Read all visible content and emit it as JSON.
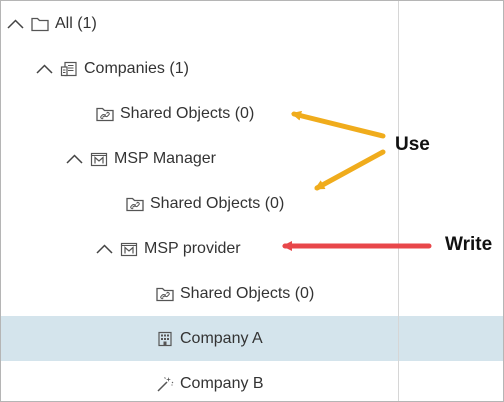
{
  "tree": {
    "items": [
      {
        "label": "All (1)",
        "icon": "folder-icon",
        "expanded": true
      },
      {
        "label": "Companies (1)",
        "icon": "companies-icon",
        "expanded": true
      },
      {
        "label": "Shared Objects (0)",
        "icon": "shared-objects-icon"
      },
      {
        "label": "MSP Manager",
        "icon": "msp-icon",
        "expanded": true
      },
      {
        "label": "Shared Objects (0)",
        "icon": "shared-objects-icon"
      },
      {
        "label": "MSP provider",
        "icon": "msp-icon",
        "expanded": true
      },
      {
        "label": "Shared Objects (0)",
        "icon": "shared-objects-icon"
      },
      {
        "label": "Company A",
        "icon": "building-icon",
        "selected": true
      },
      {
        "label": "Company B",
        "icon": "wizard-icon"
      }
    ]
  },
  "annotations": {
    "use_label": "Use",
    "write_label": "Write",
    "use_arrow_color": "#f0ac1c",
    "write_arrow_color": "#e8474a"
  },
  "colors": {
    "selected_row": "#d4e4ec",
    "text": "#333333",
    "border": "#b5b5b5"
  }
}
